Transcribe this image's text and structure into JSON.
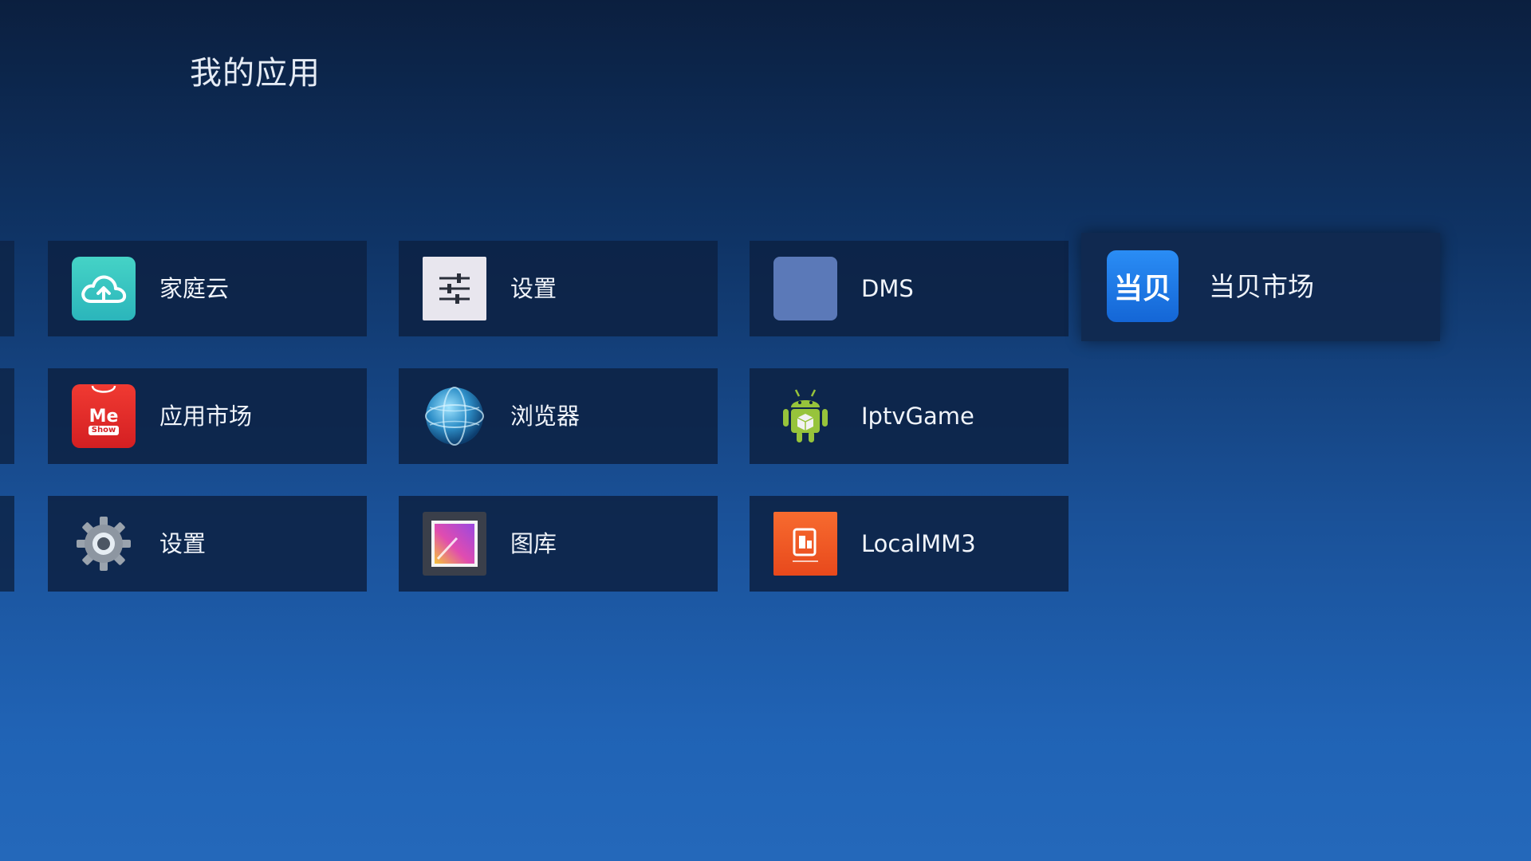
{
  "page": {
    "title": "我的应用"
  },
  "apps": {
    "r1c1": {
      "label": "家庭云",
      "icon": "cloud-icon",
      "color": "#38c6c0"
    },
    "r1c2": {
      "label": "设置",
      "icon": "sliders-icon",
      "color": "#e8e6ee"
    },
    "r1c3": {
      "label": "DMS",
      "icon": "blank-square-icon",
      "color": "#5b79b8"
    },
    "r1c4": {
      "label": "当贝市场",
      "icon": "dangbei-market-icon",
      "icon_text": "当贝",
      "color": "#1e7be8"
    },
    "r2c1": {
      "label": "应用市场",
      "icon": "meshow-bag-icon",
      "icon_text": "Me",
      "icon_subtext": "Show",
      "color": "#e12a2a"
    },
    "r2c2": {
      "label": "浏览器",
      "icon": "globe-icon",
      "color": "#2e8fc8"
    },
    "r2c3": {
      "label": "IptvGame",
      "icon": "android-icon",
      "color": "#97c43b"
    },
    "r3c1": {
      "label": "设置",
      "icon": "gear-icon",
      "color": "#9aa3ad"
    },
    "r3c2": {
      "label": "图库",
      "icon": "gallery-icon",
      "color": "#c23fc9"
    },
    "r3c3": {
      "label": "LocalMM3",
      "icon": "localmm-icon",
      "color": "#f05a24"
    }
  }
}
